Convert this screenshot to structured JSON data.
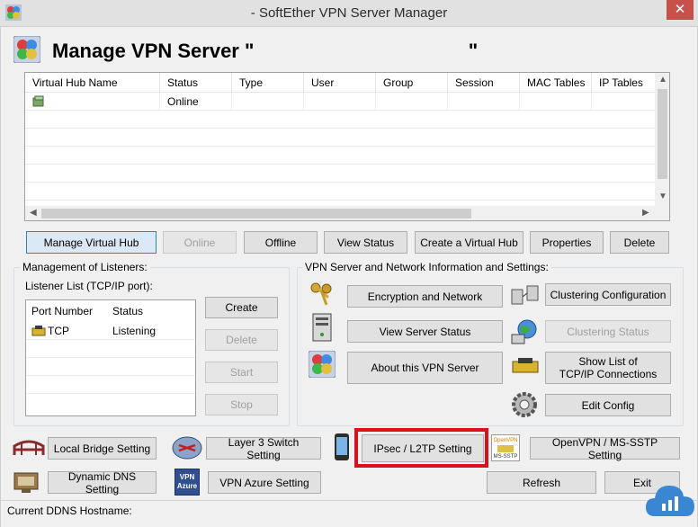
{
  "window": {
    "title": "- SoftEther VPN Server Manager",
    "close_glyph": "✕"
  },
  "header": {
    "title": "Manage VPN Server \"                                       \""
  },
  "hub_table": {
    "columns": [
      "Virtual Hub Name",
      "Status",
      "Type",
      "User",
      "Group",
      "Session",
      "MAC Tables",
      "IP Tables"
    ],
    "rows": [
      {
        "name": "",
        "status": "Online",
        "type": "",
        "user": "",
        "group": "",
        "session": "",
        "mac": "",
        "ip": ""
      }
    ]
  },
  "hub_buttons": {
    "manage": "Manage Virtual Hub",
    "online": "Online",
    "offline": "Offline",
    "view_status": "View Status",
    "create": "Create a Virtual Hub",
    "properties": "Properties",
    "delete": "Delete"
  },
  "listeners": {
    "group_title": "Management of Listeners:",
    "list_label": "Listener List (TCP/IP port):",
    "columns": [
      "Port Number",
      "Status"
    ],
    "rows": [
      {
        "port": "TCP",
        "status": "Listening"
      }
    ],
    "buttons": {
      "create": "Create",
      "delete": "Delete",
      "start": "Start",
      "stop": "Stop"
    }
  },
  "server_info": {
    "group_title": "VPN Server and Network Information and Settings:",
    "encryption": "Encryption and Network",
    "clustering_config": "Clustering Configuration",
    "view_server_status": "View Server Status",
    "clustering_status": "Clustering Status",
    "about": "About this VPN Server",
    "tcp_connections_line1": "Show List of",
    "tcp_connections_line2": "TCP/IP Connections",
    "edit_config": "Edit Config"
  },
  "bottom": {
    "local_bridge": "Local Bridge Setting",
    "layer3": "Layer 3 Switch Setting",
    "ipsec": "IPsec / L2TP Setting",
    "openvpn": "OpenVPN / MS-SSTP Setting",
    "ddns": "Dynamic DNS Setting",
    "azure": "VPN Azure Setting",
    "refresh": "Refresh",
    "exit": "Exit",
    "azure_icon_line1": "VPN",
    "azure_icon_line2": "Azure",
    "openvpn_icon_top": "OpenVPN",
    "openvpn_icon_bottom": "MS-SSTP"
  },
  "status_bar": {
    "ddns_label": "Current DDNS Hostname:"
  },
  "colors": {
    "highlight": "#d6121c",
    "close": "#c7504b",
    "primary_border": "#3c7fb1"
  }
}
